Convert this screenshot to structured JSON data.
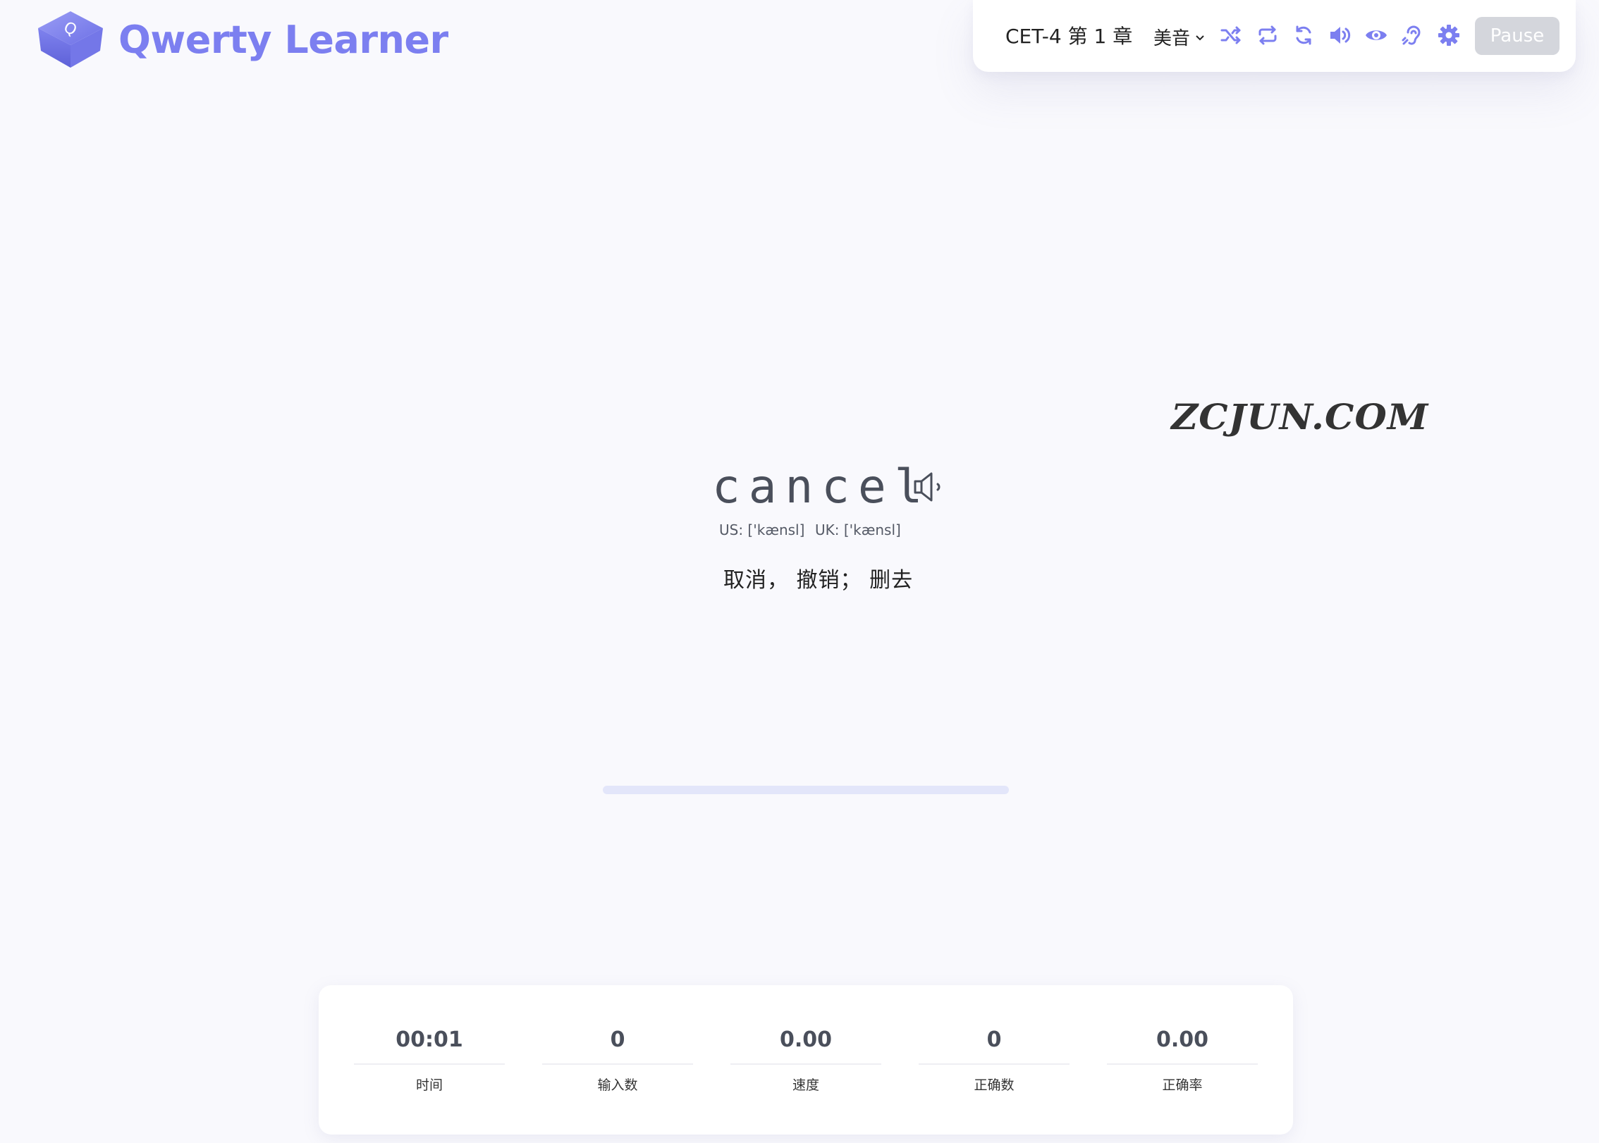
{
  "app": {
    "title": "Qwerty Learner"
  },
  "toolbar": {
    "dictionary": "CET-4 第 1 章",
    "accent": "美音",
    "icons": [
      "shuffle-icon",
      "loop-icon",
      "repeat-icon",
      "volume-icon",
      "eye-icon",
      "ear-icon",
      "gear-icon"
    ],
    "pause_label": "Pause",
    "accent_color": "#7c7ff0"
  },
  "watermark": "ZCJUN.COM",
  "word": {
    "text": "cancel",
    "phonetic_us": "US: ['kænsl]",
    "phonetic_uk": "UK: ['kænsl]",
    "translation": "取消， 撤销； 删去"
  },
  "progress": {
    "fraction": 0
  },
  "stats": [
    {
      "value": "00:01",
      "label": "时间"
    },
    {
      "value": "0",
      "label": "输入数"
    },
    {
      "value": "0.00",
      "label": "速度"
    },
    {
      "value": "0",
      "label": "正确数"
    },
    {
      "value": "0.00",
      "label": "正确率"
    }
  ]
}
